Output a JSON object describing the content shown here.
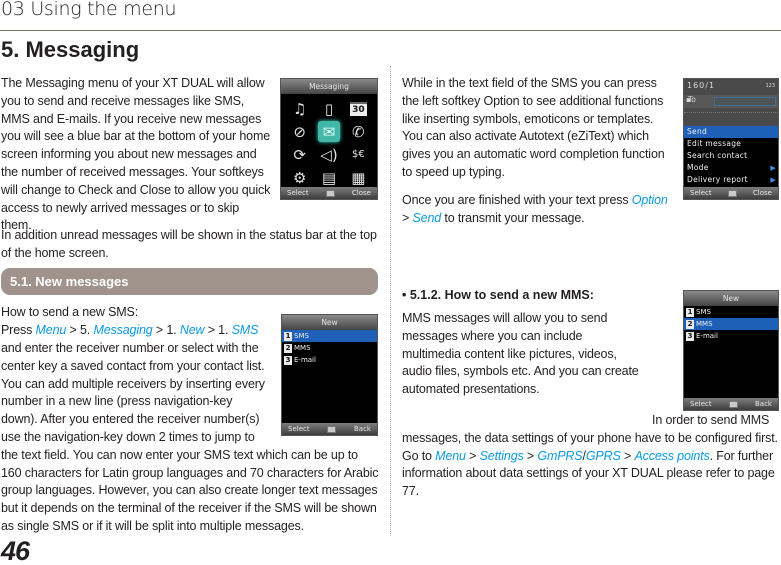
{
  "header": {
    "chapter": "03 Using the menu",
    "section": "5. Messaging"
  },
  "left": {
    "intro": "The Messaging menu of your XT DUAL will allow you to send and receive messages like SMS, MMS and E-mails. If you receive new messages you will see a blue bar at the bottom of your home screen informing you about new messages and the number of received messages. Your softkeys will change to Check and Close to allow you quick access to newly arrived messages or to skip them.",
    "status_bar_note": "In addition unread messages will be shown in the status bar at the top of the home screen.",
    "subsection": "5.1. New messages",
    "how_to_sms": {
      "line1": "How to send a new SMS:",
      "press": "Press ",
      "menu": "Menu",
      "sep1": " > 5. ",
      "messaging": "Messaging",
      "sep2": " > 1. ",
      "new": "New",
      "sep3": " > 1. ",
      "sms": "SMS",
      "rest": "and enter the receiver number or select with the center key a saved contact from your contact list. You can add multiple receivers by inserting every number in a new line (press navigation-key down). After you entered the receiver number(s) use the navigation-key down 2 times to jump to the text field. You can now enter your SMS text which can be up to 160 characters for Latin group languages and 70 characters for Arabic group languages. However, you can also create longer text messages but it depends on the terminal of the receiver if the SMS will be shown as single SMS or if it will be split into multiple messages."
    }
  },
  "right": {
    "option_text": "While in the text field of the SMS you can press the left softkey Option to see additional functions like inserting symbols, emoticons or templates. You can also activate Autotext (eZiText) which gives you an automatic word completion function to speed up typing.",
    "finish": {
      "prefix": "Once you are finished with your text press ",
      "option": "Option",
      "sep": " > ",
      "send": "Send",
      "suffix": " to transmit your message."
    },
    "mms_heading": "5.1.2. How to send a new MMS:",
    "mms_text": "MMS messages will allow you to send messages where you can include multimedia content like pictures, videos, audio files, symbols etc. And you can create automated presentations.",
    "mms_settings": {
      "prefix": "In order to send MMS messages, the data settings of your phone have to be configured first. Go to ",
      "menu": "Menu",
      "sep1": " > ",
      "settings": "Settings",
      "sep2": " > ",
      "gmprs": "GmPRS",
      "slash": "/",
      "gprs": "GPRS",
      "sep3": " > ",
      "access_points": "Access points",
      "suffix": ". For further information about data settings of your XT DUAL please refer to page 77."
    }
  },
  "screens": {
    "messaging": {
      "title": "Messaging",
      "icons": [
        "music-icon",
        "phonebook-icon",
        "calendar-icon",
        "browser-icon",
        "messaging-icon",
        "call-icon",
        "sync-icon",
        "sound-icon",
        "converter-icon",
        "settings-icon",
        "organizer-icon",
        "files-icon"
      ],
      "calendar_day": "30",
      "left_softkey": "Select",
      "right_softkey": "Close"
    },
    "new_sms": {
      "title": "New",
      "items": [
        {
          "num": "1",
          "label": "SMS"
        },
        {
          "num": "2",
          "label": "MMS"
        },
        {
          "num": "3",
          "label": "E-mail"
        }
      ],
      "selected": "SMS",
      "left_softkey": "Select",
      "right_softkey": "Back"
    },
    "sms_options": {
      "counter": "160/1",
      "mode_indicator": "123",
      "to_label": "To",
      "items": [
        "Send",
        "Edit message",
        "Search contact",
        "Mode",
        "Delivery report"
      ],
      "selected": "Send",
      "left_softkey": "Select",
      "right_softkey": "Close"
    },
    "new_mms": {
      "title": "New",
      "items": [
        {
          "num": "1",
          "label": "SMS"
        },
        {
          "num": "2",
          "label": "MMS"
        },
        {
          "num": "3",
          "label": "E-mail"
        }
      ],
      "selected": "MMS",
      "left_softkey": "Select",
      "right_softkey": "Back"
    }
  },
  "footer": {
    "page_number": "46"
  },
  "colors": {
    "link": "#0a9ae0",
    "subsection_bar": "#a0938b",
    "selection_blue": "#1e5fb8",
    "selected_icon": "#43b7a8"
  }
}
